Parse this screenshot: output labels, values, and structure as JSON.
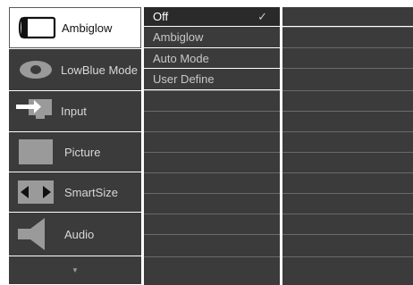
{
  "main_menu": {
    "items": [
      {
        "label": "Ambiglow",
        "icon": "ambiglow-icon"
      },
      {
        "label": "LowBlue Mode",
        "icon": "eye-icon"
      },
      {
        "label": "Input",
        "icon": "input-arrow-icon"
      },
      {
        "label": "Picture",
        "icon": "picture-icon"
      },
      {
        "label": "SmartSize",
        "icon": "resize-arrows-icon"
      },
      {
        "label": "Audio",
        "icon": "speaker-icon"
      }
    ],
    "more_indicator": "▼",
    "selected": "Ambiglow"
  },
  "submenu": {
    "options": [
      {
        "label": "Off",
        "checked": true
      },
      {
        "label": "Ambiglow",
        "checked": false
      },
      {
        "label": "Auto Mode",
        "checked": false
      },
      {
        "label": "User Define",
        "checked": false
      }
    ],
    "check_glyph": "✓"
  },
  "colors": {
    "panel": "#3b3b3b",
    "active_row": "#2a2a2a",
    "selected_item": "#ffffff"
  }
}
